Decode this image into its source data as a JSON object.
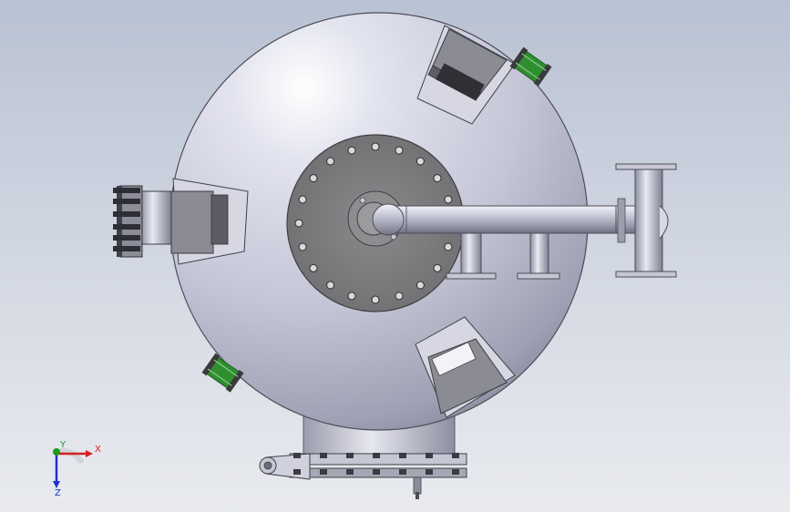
{
  "viewport": {
    "background_top": "#b9c2d3",
    "background_bottom": "#e9ebef"
  },
  "model": {
    "body_color": "#c8c9da",
    "manway_color": "#7d7d7f",
    "flange_accent_color": "#2f8f2f",
    "bolt_count_manway": 20
  },
  "triad": {
    "x_label": "X",
    "y_label": "Y",
    "z_label": "Z",
    "x_color": "#d42020",
    "y_color": "#1f9a1f",
    "z_color": "#2030c8"
  }
}
